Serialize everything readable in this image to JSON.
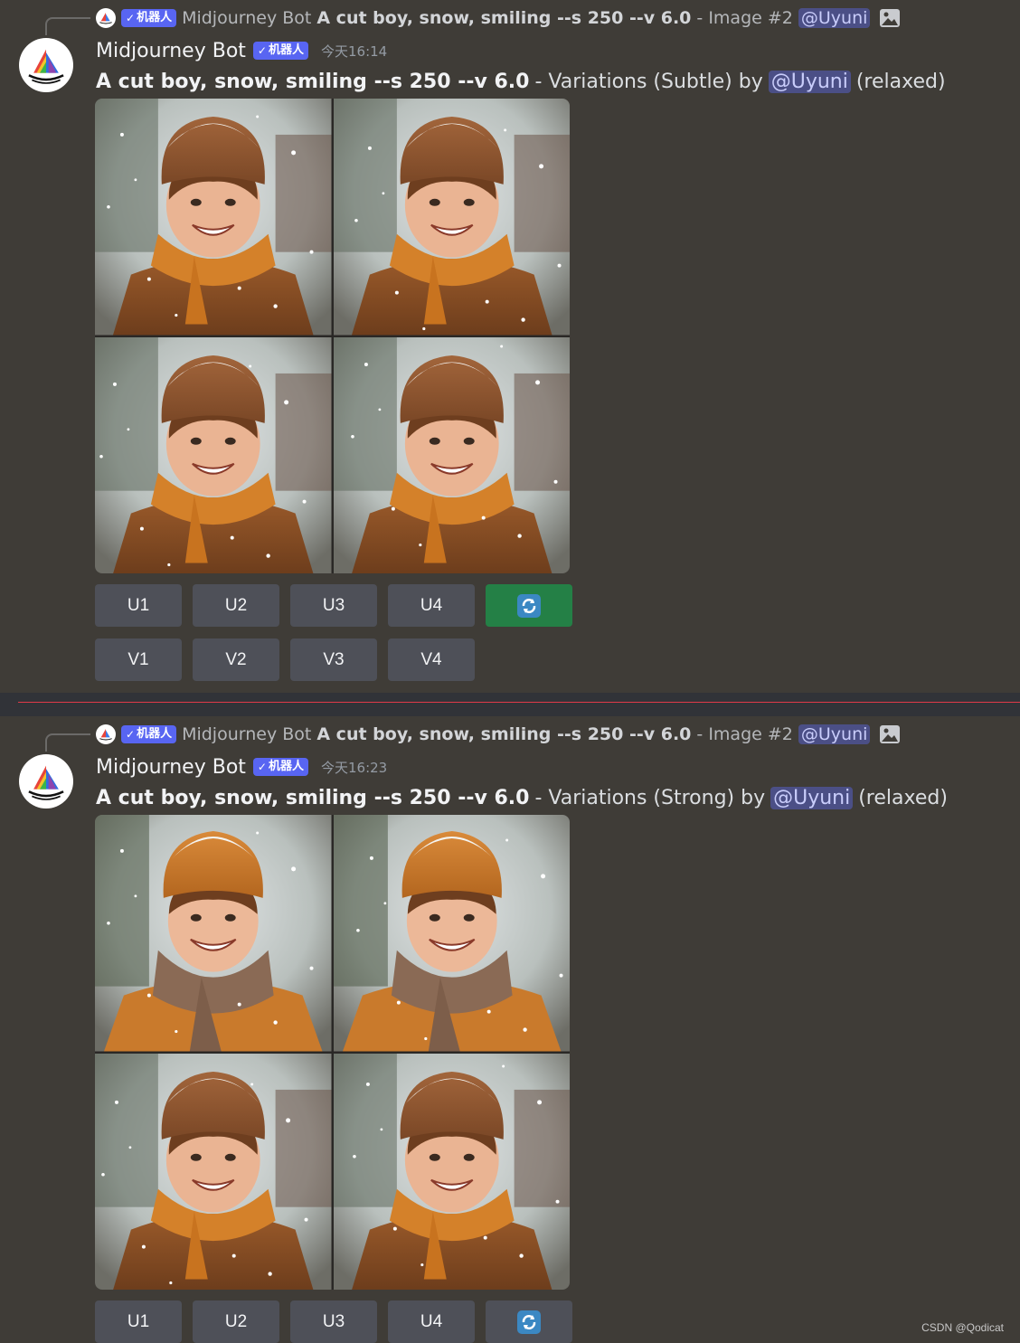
{
  "messages": [
    {
      "reply": {
        "bot_tag": "机器人",
        "author": "Midjourney Bot",
        "prompt": "A cut boy, snow, smiling --s 250 --v 6.0",
        "suffix": "- Image #2",
        "mention": "@Uyuni",
        "icon": "image-icon"
      },
      "author": "Midjourney Bot",
      "bot_tag": "机器人",
      "timestamp": "今天16:14",
      "content": {
        "prompt": "A cut boy, snow, smiling --s 250 --v 6.0",
        "action": "- Variations (Subtle) by",
        "mention": "@Uyuni",
        "mode": "(relaxed)"
      },
      "upscale_buttons": [
        "U1",
        "U2",
        "U3",
        "U4"
      ],
      "reroll_icon": "refresh-icon",
      "reroll_active": true,
      "variation_buttons": [
        "V1",
        "V2",
        "V3",
        "V4"
      ]
    },
    {
      "reply": {
        "bot_tag": "机器人",
        "author": "Midjourney Bot",
        "prompt": "A cut boy, snow, smiling --s 250 --v 6.0",
        "suffix": "- Image #2",
        "mention": "@Uyuni",
        "icon": "image-icon"
      },
      "author": "Midjourney Bot",
      "bot_tag": "机器人",
      "timestamp": "今天16:23",
      "content": {
        "prompt": "A cut boy, snow, smiling --s 250 --v 6.0",
        "action": "- Variations (Strong) by",
        "mention": "@Uyuni",
        "mode": "(relaxed)"
      },
      "upscale_buttons": [
        "U1",
        "U2",
        "U3",
        "U4"
      ],
      "reroll_icon": "refresh-icon",
      "reroll_active": false
    }
  ],
  "watermark": "CSDN @Qodicat",
  "colors": {
    "background": "#3f3c37",
    "button": "#4e5058",
    "button_active": "#248046",
    "bot_tag": "#5865f2",
    "mention_bg": "#4b4f86",
    "new_divider": "#e03a48"
  }
}
